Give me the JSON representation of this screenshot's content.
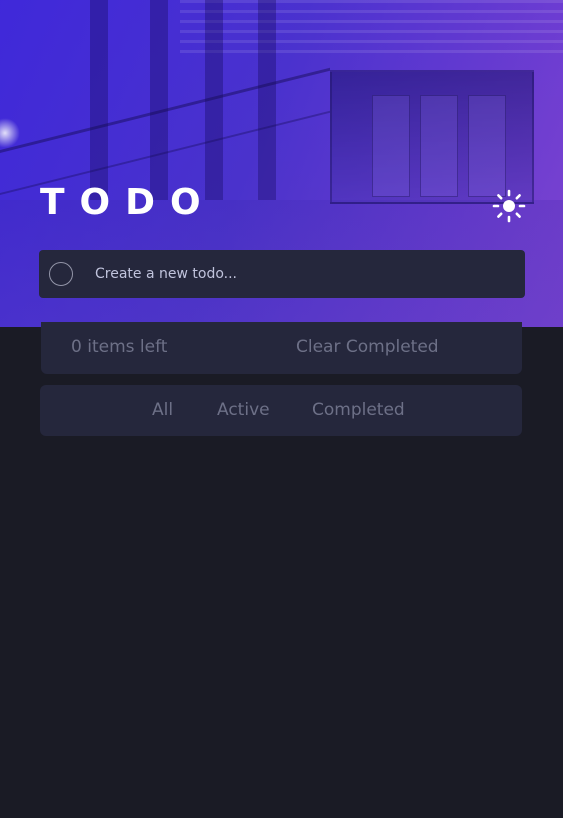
{
  "header": {
    "title": "TODO",
    "theme_icon": "sun-icon"
  },
  "create": {
    "placeholder": "Create a new todo..."
  },
  "footer": {
    "items_left": "0 items left",
    "clear_label": "Clear Completed"
  },
  "filters": {
    "all": "All",
    "active": "Active",
    "completed": "Completed"
  },
  "colors": {
    "background": "#1a1b25",
    "panel": "#25273c",
    "muted_text": "#6d7087",
    "hero_gradient_start": "#4028dc",
    "hero_gradient_end": "#8c46d7"
  }
}
